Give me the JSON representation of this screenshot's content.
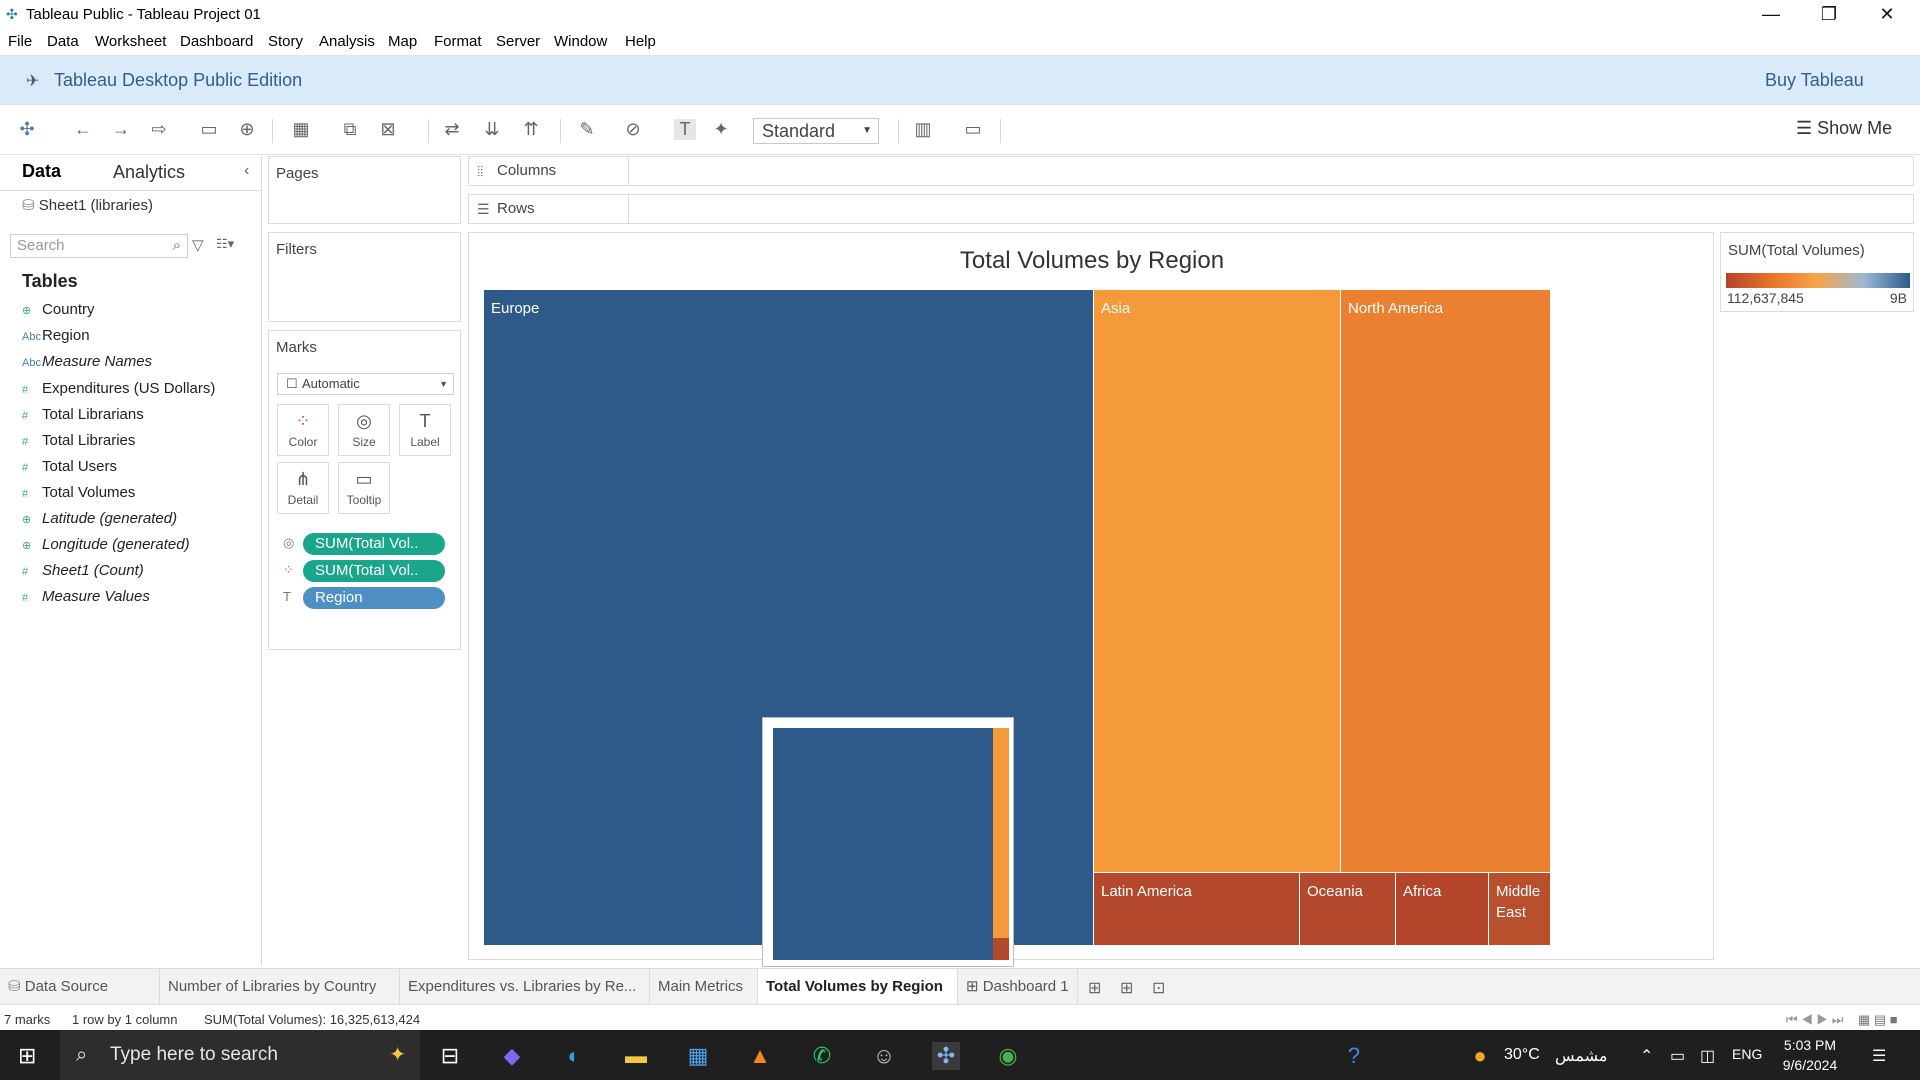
{
  "window": {
    "title": "Tableau Public - Tableau Project 01",
    "minimize": "—",
    "restore": "❐",
    "close": "✕"
  },
  "menu": [
    "File",
    "Data",
    "Worksheet",
    "Dashboard",
    "Story",
    "Analysis",
    "Map",
    "Format",
    "Server",
    "Window",
    "Help"
  ],
  "banner": {
    "edition": "Tableau Desktop Public Edition",
    "buy": "Buy Tableau"
  },
  "toolbar": {
    "fit_select": "Standard",
    "show_me": "Show Me"
  },
  "datapane": {
    "tab_data": "Data",
    "tab_analytics": "Analytics",
    "source": "Sheet1 (libraries)",
    "search_placeholder": "Search",
    "tables_heading": "Tables",
    "fields": [
      {
        "type": "geo",
        "name": "Country"
      },
      {
        "type": "abc",
        "name": "Region"
      },
      {
        "type": "abc",
        "name": "Measure Names"
      },
      {
        "type": "num",
        "name": "Expenditures  (US Dollars)"
      },
      {
        "type": "num",
        "name": "Total Librarians"
      },
      {
        "type": "num",
        "name": "Total Libraries"
      },
      {
        "type": "num",
        "name": "Total Users"
      },
      {
        "type": "num",
        "name": "Total Volumes"
      },
      {
        "type": "geo",
        "name": "Latitude (generated)"
      },
      {
        "type": "geo",
        "name": "Longitude (generated)"
      },
      {
        "type": "num",
        "name": "Sheet1 (Count)"
      },
      {
        "type": "num",
        "name": "Measure Values"
      }
    ]
  },
  "cards": {
    "pages": "Pages",
    "filters": "Filters",
    "marks": "Marks",
    "mark_type": "Automatic",
    "mark_buttons": [
      "Color",
      "Size",
      "Label",
      "Detail",
      "Tooltip"
    ],
    "pills": [
      {
        "label": "SUM(Total Vol..",
        "color": "#1aa68a"
      },
      {
        "label": "SUM(Total Vol..",
        "color": "#1aa68a"
      },
      {
        "label": "Region",
        "color": "#4e8fc4"
      }
    ]
  },
  "shelves": {
    "columns": "Columns",
    "rows": "Rows"
  },
  "chart_data": {
    "type": "treemap",
    "title": "Total Volumes by Region",
    "measure": "SUM(Total Volumes)",
    "regions": [
      {
        "name": "Europe",
        "color": "#2e5a8a"
      },
      {
        "name": "Asia",
        "color": "#f49a3a"
      },
      {
        "name": "North America",
        "color": "#ea8030"
      },
      {
        "name": "Latin America",
        "color": "#b4482c"
      },
      {
        "name": "Oceania",
        "color": "#b4482c"
      },
      {
        "name": "Africa",
        "color": "#b2452a"
      },
      {
        "name": "Middle East",
        "color": "#b8502e"
      }
    ],
    "legend": {
      "title": "SUM(Total Volumes)",
      "min_label": "112,637,845",
      "max_label": "9B"
    }
  },
  "sheet_tabs": [
    "Data Source",
    "Number of Libraries by Country",
    "Expenditures vs. Libraries by Re...",
    "Main Metrics",
    "Total Volumes by Region",
    "Dashboard 1"
  ],
  "status": {
    "marks": "7 marks",
    "dims": "1 row by 1 column",
    "sum": "SUM(Total Volumes): 16,325,613,424"
  },
  "taskbar": {
    "search_placeholder": "Type here to search",
    "weather": "30°C",
    "weather_text": "مشمس",
    "lang": "ENG",
    "time": "5:03 PM",
    "date": "9/6/2024"
  }
}
